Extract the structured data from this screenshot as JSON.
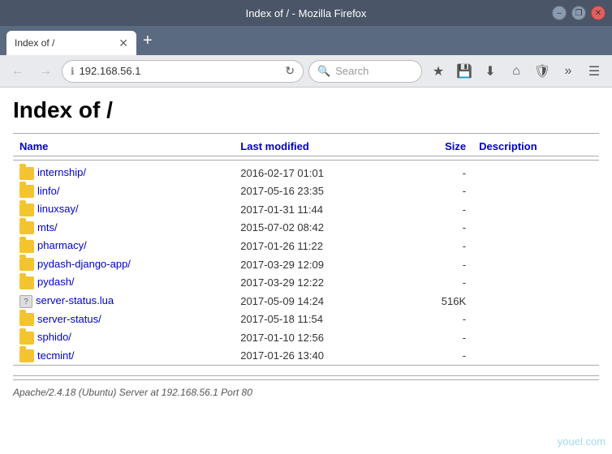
{
  "titlebar": {
    "title": "Index of / - Mozilla Firefox",
    "controls": {
      "minimize": "–",
      "restore": "❒",
      "close": "✕"
    }
  },
  "tab": {
    "label": "Index of /",
    "close": "✕"
  },
  "new_tab": "+",
  "navbar": {
    "back": "←",
    "forward": "→",
    "reload": "↻",
    "home": "⌂",
    "address": "192.168.56.1",
    "info_icon": "ℹ",
    "search_placeholder": "Search",
    "bookmark_icon": "★",
    "save_icon": "💾",
    "download_icon": "⬇",
    "menu_icon": "☰",
    "more_icon": "»",
    "shield_icon": "🛡"
  },
  "page": {
    "title": "Index of /",
    "table": {
      "headers": {
        "name": "Name",
        "last_modified": "Last modified",
        "size": "Size",
        "description": "Description"
      },
      "rows": [
        {
          "icon": "folder",
          "name": "internship/",
          "href": "internship/",
          "last_modified": "2016-02-17 01:01",
          "size": "-",
          "description": ""
        },
        {
          "icon": "folder",
          "name": "linfo/",
          "href": "linfo/",
          "last_modified": "2017-05-16 23:35",
          "size": "-",
          "description": ""
        },
        {
          "icon": "folder",
          "name": "linuxsay/",
          "href": "linuxsay/",
          "last_modified": "2017-01-31 11:44",
          "size": "-",
          "description": ""
        },
        {
          "icon": "folder",
          "name": "mts/",
          "href": "mts/",
          "last_modified": "2015-07-02 08:42",
          "size": "-",
          "description": ""
        },
        {
          "icon": "folder",
          "name": "pharmacy/",
          "href": "pharmacy/",
          "last_modified": "2017-01-26 11:22",
          "size": "-",
          "description": ""
        },
        {
          "icon": "folder",
          "name": "pydash-django-app/",
          "href": "pydash-django-app/",
          "last_modified": "2017-03-29 12:09",
          "size": "-",
          "description": ""
        },
        {
          "icon": "folder",
          "name": "pydash/",
          "href": "pydash/",
          "last_modified": "2017-03-29 12:22",
          "size": "-",
          "description": ""
        },
        {
          "icon": "unknown",
          "name": "server-status.lua",
          "href": "server-status.lua",
          "last_modified": "2017-05-09 14:24",
          "size": "516K",
          "description": ""
        },
        {
          "icon": "folder",
          "name": "server-status/",
          "href": "server-status/",
          "last_modified": "2017-05-18 11:54",
          "size": "-",
          "description": ""
        },
        {
          "icon": "folder",
          "name": "sphido/",
          "href": "sphido/",
          "last_modified": "2017-01-10 12:56",
          "size": "-",
          "description": ""
        },
        {
          "icon": "folder",
          "name": "tecmint/",
          "href": "tecmint/",
          "last_modified": "2017-01-26 13:40",
          "size": "-",
          "description": ""
        }
      ],
      "footer": "Apache/2.4.18 (Ubuntu) Server at 192.168.56.1 Port 80"
    }
  },
  "watermark": "youel.com"
}
